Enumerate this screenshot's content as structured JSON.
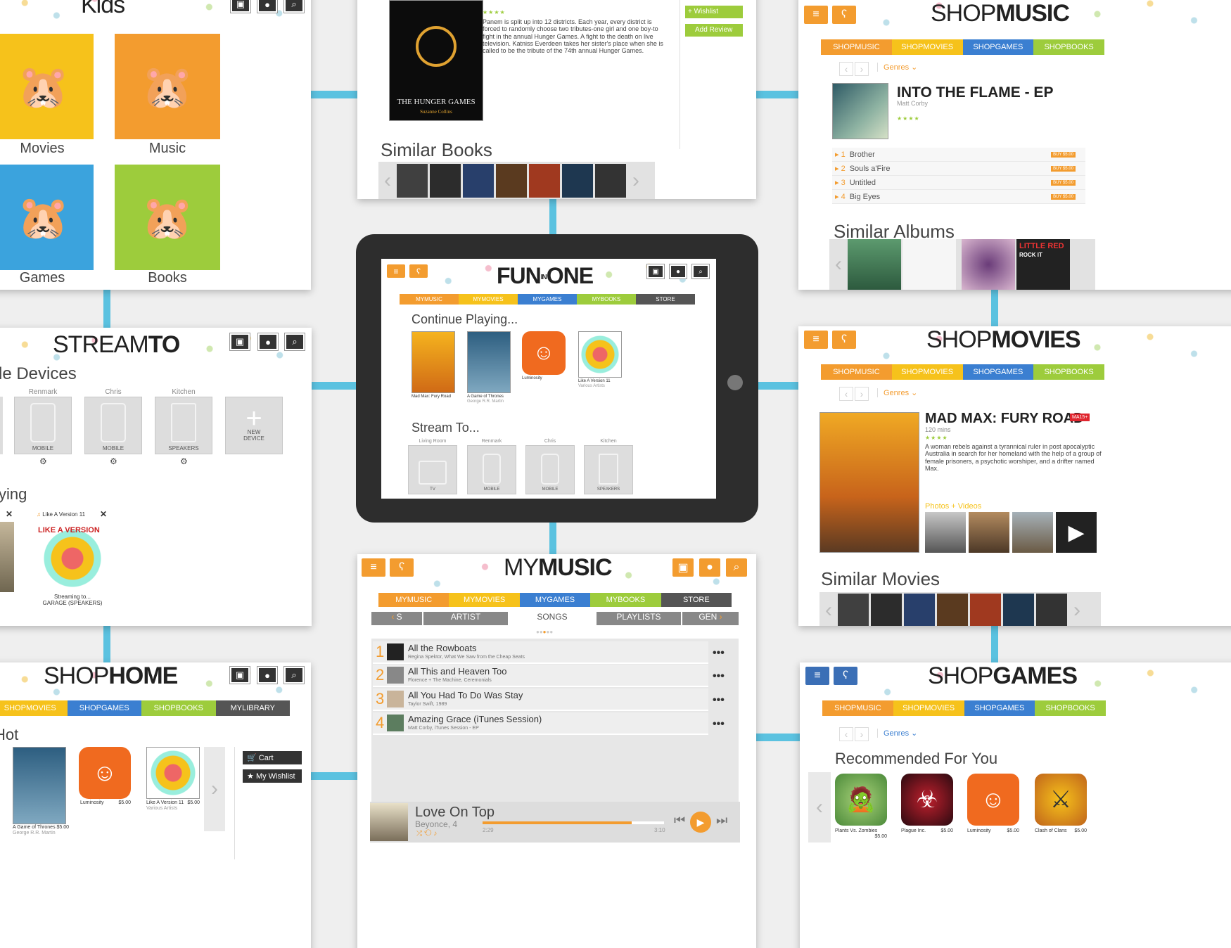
{
  "kids": {
    "title": "Kids",
    "tiles": [
      "Movies",
      "Music",
      "Games",
      "Books"
    ]
  },
  "book_detail": {
    "cover_title": "THE HUNGER GAMES",
    "cover_author": "Suzanne Collins",
    "description": "Panem is split up into 12 districts. Each year, every district is forced to randomly choose two tributes-one girl and one boy-to fight in the annual Hunger Games. A fight to the death on live television. Katniss Everdeen takes her sister's place when she is called to be the tribute of the 74th annual Hunger Games.",
    "wishlist": "+ Wishlist",
    "add_review": "Add Review",
    "similar_title": "Similar Books"
  },
  "shop_music": {
    "logo_light": "SHOP",
    "logo_bold": "MUSIC",
    "tabs": [
      "SHOPMUSIC",
      "SHOPMOVIES",
      "SHOPGAMES",
      "SHOPBOOKS"
    ],
    "genres": "Genres",
    "album_title": "INTO THE FLAME - EP",
    "artist": "Matt Corby",
    "tracks": [
      {
        "num": "1",
        "name": "Brother"
      },
      {
        "num": "2",
        "name": "Souls a'Fire"
      },
      {
        "num": "3",
        "name": "Untitled"
      },
      {
        "num": "4",
        "name": "Big Eyes"
      }
    ],
    "buy_label": "BUY $5.00",
    "similar_title": "Similar Albums",
    "similar_badge": "LITTLE RED",
    "similar_badge_sub": "ROCK IT"
  },
  "stream_to": {
    "logo_light": "STREAM",
    "logo_bold": "TO",
    "devices_title": "le Devices",
    "devices": [
      {
        "owner": "Renmark",
        "type": "MOBILE"
      },
      {
        "owner": "Chris",
        "type": "MOBILE"
      },
      {
        "owner": "Kitchen",
        "type": "SPEAKERS"
      }
    ],
    "new_device": "NEW DEVICE",
    "playing_title": "ying",
    "now_playing_song": "Like A Version 11",
    "album_art_title": "LIKE A VERSION",
    "streaming_to": "Streaming to...",
    "streaming_target": "GARAGE (SPEAKERS)"
  },
  "tablet": {
    "logo_left": "FUN",
    "logo_mid": "IN",
    "logo_right": "ONE",
    "tabs": [
      "MYMUSIC",
      "MYMOVIES",
      "MYGAMES",
      "MYBOOKS",
      "STORE"
    ],
    "continue_title": "Continue Playing...",
    "continue_items": [
      {
        "title": "Mad Max: Fury Road",
        "sub": ""
      },
      {
        "title": "A Game of Thrones",
        "sub": "George R.R. Martin"
      },
      {
        "title": "Luminosity",
        "sub": ""
      },
      {
        "title": "Like A Version 11",
        "sub": "Various Artists"
      }
    ],
    "stream_title": "Stream To...",
    "stream_devices": [
      {
        "owner": "Living Room",
        "type": "TV"
      },
      {
        "owner": "Renmark",
        "type": "MOBILE"
      },
      {
        "owner": "Chris",
        "type": "MOBILE"
      },
      {
        "owner": "Kitchen",
        "type": "SPEAKERS"
      }
    ]
  },
  "shop_movies": {
    "logo_light": "SHOP",
    "logo_bold": "MOVIES",
    "tabs": [
      "SHOPMUSIC",
      "SHOPMOVIES",
      "SHOPGAMES",
      "SHOPBOOKS"
    ],
    "genres": "Genres",
    "movie_title": "MAD MAX: FURY ROAD",
    "rating": "MA15+",
    "runtime": "120 mins",
    "description": "A woman rebels against a tyrannical ruler in post apocalyptic Australia in search for her homeland with the help of a group of female prisoners, a psychotic worshiper, and a drifter named Max.",
    "photos_label": "Photos + Videos",
    "similar_title": "Similar Movies"
  },
  "my_music": {
    "logo_light": "MY",
    "logo_bold": "MUSIC",
    "tabs": [
      "MYMUSIC",
      "MYMOVIES",
      "MYGAMES",
      "MYBOOKS",
      "STORE"
    ],
    "subtabs": [
      "S",
      "ARTIST",
      "SONGS",
      "PLAYLISTS",
      "GEN"
    ],
    "songs": [
      {
        "num": "1",
        "title": "All the Rowboats",
        "sub": "Regina Spektor, What We Saw from the Cheap Seats"
      },
      {
        "num": "2",
        "title": "All This and Heaven Too",
        "sub": "Florence + The Machine, Ceremonials"
      },
      {
        "num": "3",
        "title": "All You Had To Do Was Stay",
        "sub": "Taylor Swift, 1989"
      },
      {
        "num": "4",
        "title": "Amazing Grace (iTunes Session)",
        "sub": "Matt Corby, iTunes Session - EP"
      }
    ],
    "player": {
      "title": "Love On Top",
      "artist": "Beyonce, 4",
      "elapsed": "2:29",
      "total": "3:10",
      "progress": 0.82
    }
  },
  "shop_home": {
    "logo_light": "SHOP",
    "logo_bold": "HOME",
    "tabs": [
      "SHOPMOVIES",
      "SHOPGAMES",
      "SHOPBOOKS",
      "MYLIBRARY"
    ],
    "hot_title": "Hot",
    "items": [
      {
        "title": "A Game of Thrones",
        "sub": "George R.R. Martin",
        "price": "$5.00"
      },
      {
        "title": "Luminosity",
        "sub": "",
        "price": "$5.00"
      },
      {
        "title": "Like A Version 11",
        "sub": "Various Artists",
        "price": "$5.00"
      }
    ],
    "cart": "Cart",
    "wishlist": "My Wishlist"
  },
  "shop_games": {
    "logo_light": "SHOP",
    "logo_bold": "GAMES",
    "tabs": [
      "SHOPMUSIC",
      "SHOPMOVIES",
      "SHOPGAMES",
      "SHOPBOOKS"
    ],
    "genres": "Genres",
    "recommended_title": "Recommended For You",
    "games": [
      {
        "title": "Plants Vs. Zombies",
        "price": "$5.00"
      },
      {
        "title": "Plague Inc.",
        "price": "$5.00"
      },
      {
        "title": "Luminosity",
        "price": "$5.00"
      },
      {
        "title": "Clash of Clans",
        "price": "$5.00"
      }
    ]
  },
  "colors": {
    "orange": "#f39c2f",
    "yellow": "#f6c21b",
    "blue": "#3b7fd1",
    "green": "#9dcc3c",
    "connector": "#5bc2e0"
  }
}
